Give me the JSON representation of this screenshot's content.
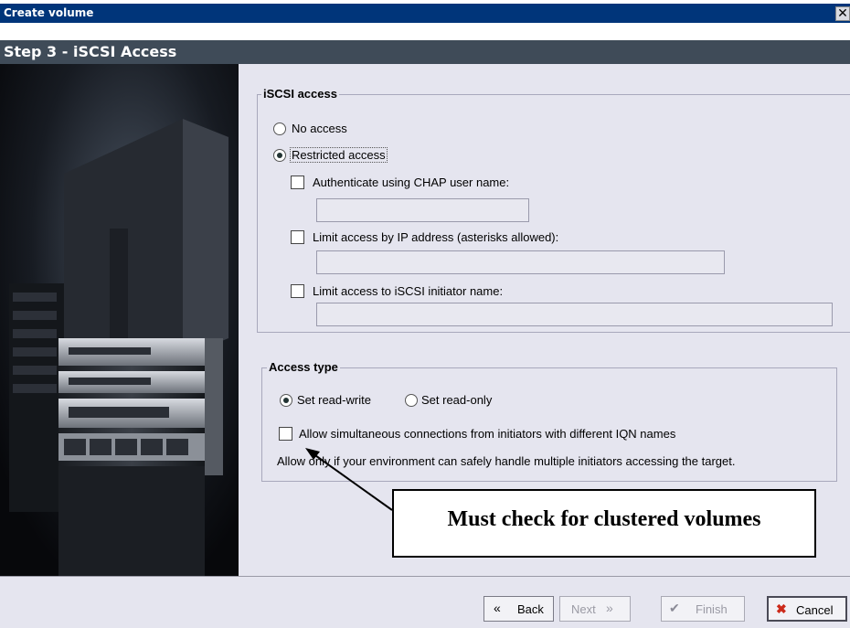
{
  "window": {
    "title": "Create volume",
    "close_glyph": "✕"
  },
  "step": {
    "title": "Step 3 - iSCSI Access"
  },
  "iscsi_access": {
    "legend": "iSCSI access",
    "no_access": "No access",
    "restricted_access": "Restricted access",
    "chap_label": "Authenticate using CHAP user name:",
    "chap_value": "",
    "ip_label": "Limit access by IP address (asterisks allowed):",
    "ip_value": "",
    "initiator_label": "Limit access to iSCSI initiator name:",
    "initiator_value": ""
  },
  "access_type": {
    "legend": "Access type",
    "read_write": "Set read-write",
    "read_only": "Set read-only",
    "simultaneous_label": "Allow simultaneous connections from initiators with different IQN names",
    "note": "Allow only if your environment can safely handle multiple initiators accessing the target."
  },
  "annotation": {
    "text": "Must check for clustered volumes"
  },
  "buttons": {
    "back": "Back",
    "next": "Next",
    "finish": "Finish",
    "cancel": "Cancel"
  },
  "icons": {
    "back": "double-chevron-left-icon",
    "next": "double-chevron-right-icon",
    "finish": "checkmark-icon",
    "cancel": "red-x-icon",
    "close": "close-icon"
  },
  "colors": {
    "titlebar": "#00357a",
    "stepbar": "#3f4b58",
    "panel": "#e5e5ef"
  }
}
